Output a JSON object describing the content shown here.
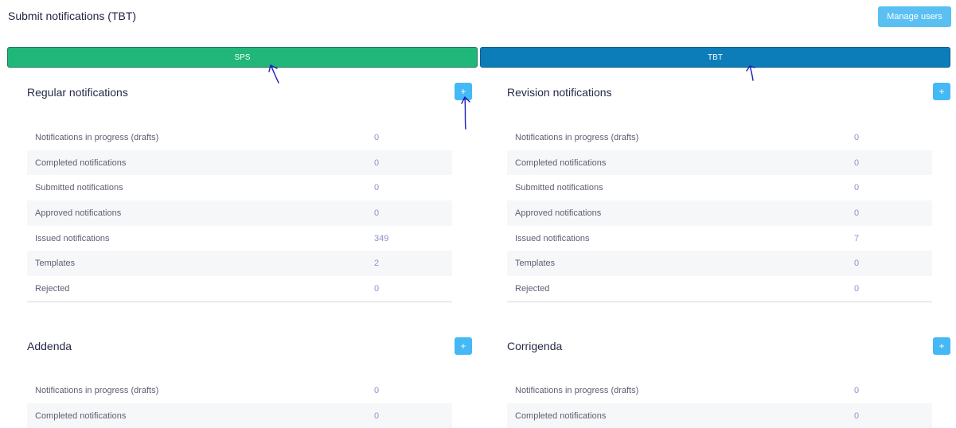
{
  "page": {
    "title": "Submit notifications (TBT)",
    "manage_users_label": "Manage users"
  },
  "tabs": [
    {
      "label": "SPS",
      "color": "#21b77a"
    },
    {
      "label": "TBT",
      "color": "#0c7db8"
    }
  ],
  "add_button_symbol": "+",
  "sections": {
    "regular": {
      "title": "Regular notifications",
      "rows": [
        {
          "label": "Notifications in progress (drafts)",
          "value": "0"
        },
        {
          "label": "Completed notifications",
          "value": "0"
        },
        {
          "label": "Submitted notifications",
          "value": "0"
        },
        {
          "label": "Approved notifications",
          "value": "0"
        },
        {
          "label": "Issued notifications",
          "value": "349"
        },
        {
          "label": "Templates",
          "value": "2"
        },
        {
          "label": "Rejected",
          "value": "0"
        }
      ]
    },
    "revision": {
      "title": "Revision notifications",
      "rows": [
        {
          "label": "Notifications in progress (drafts)",
          "value": "0"
        },
        {
          "label": "Completed notifications",
          "value": "0"
        },
        {
          "label": "Submitted notifications",
          "value": "0"
        },
        {
          "label": "Approved notifications",
          "value": "0"
        },
        {
          "label": "Issued notifications",
          "value": "7"
        },
        {
          "label": "Templates",
          "value": "0"
        },
        {
          "label": "Rejected",
          "value": "0"
        }
      ]
    },
    "addenda": {
      "title": "Addenda",
      "rows": [
        {
          "label": "Notifications in progress (drafts)",
          "value": "0"
        },
        {
          "label": "Completed notifications",
          "value": "0"
        }
      ]
    },
    "corrigenda": {
      "title": "Corrigenda",
      "rows": [
        {
          "label": "Notifications in progress (drafts)",
          "value": "0"
        },
        {
          "label": "Completed notifications",
          "value": "0"
        }
      ]
    }
  },
  "colors": {
    "add_button": "#45b9f5",
    "manage_button": "#5ac0f2",
    "value_text": "#8a93c9",
    "annotation_ink": "#1b1bb8"
  }
}
